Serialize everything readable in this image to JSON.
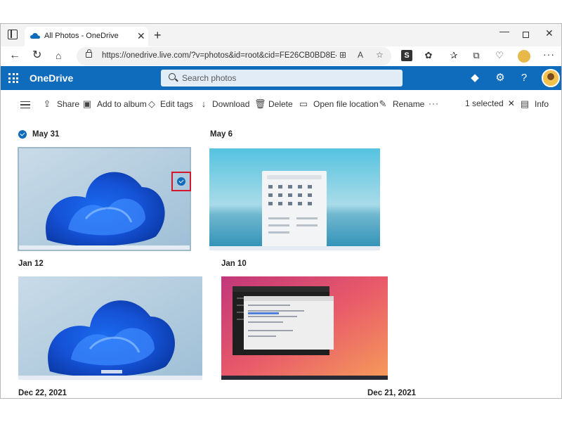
{
  "browser": {
    "tab_title": "All Photos - OneDrive",
    "url": "https://onedrive.live.com/?v=photos&id=root&cid=FE26CB0BD8E46A6..."
  },
  "header": {
    "brand": "OneDrive",
    "search_placeholder": "Search photos"
  },
  "toolbar": {
    "share": "Share",
    "add_to_album": "Add to album",
    "edit_tags": "Edit tags",
    "download": "Download",
    "delete": "Delete",
    "open_file_location": "Open file location",
    "rename": "Rename",
    "more": "···",
    "selected_count": "1 selected",
    "info": "Info"
  },
  "groups": [
    {
      "date": "May 31",
      "selected": true
    },
    {
      "date": "May 6"
    },
    {
      "date": "Jan 12"
    },
    {
      "date": "Jan 10"
    },
    {
      "date": "Dec 22, 2021"
    },
    {
      "date": "Dec 21, 2021"
    }
  ],
  "colors": {
    "brand_blue": "#0f6cbd",
    "highlight_red": "#d3182b"
  }
}
